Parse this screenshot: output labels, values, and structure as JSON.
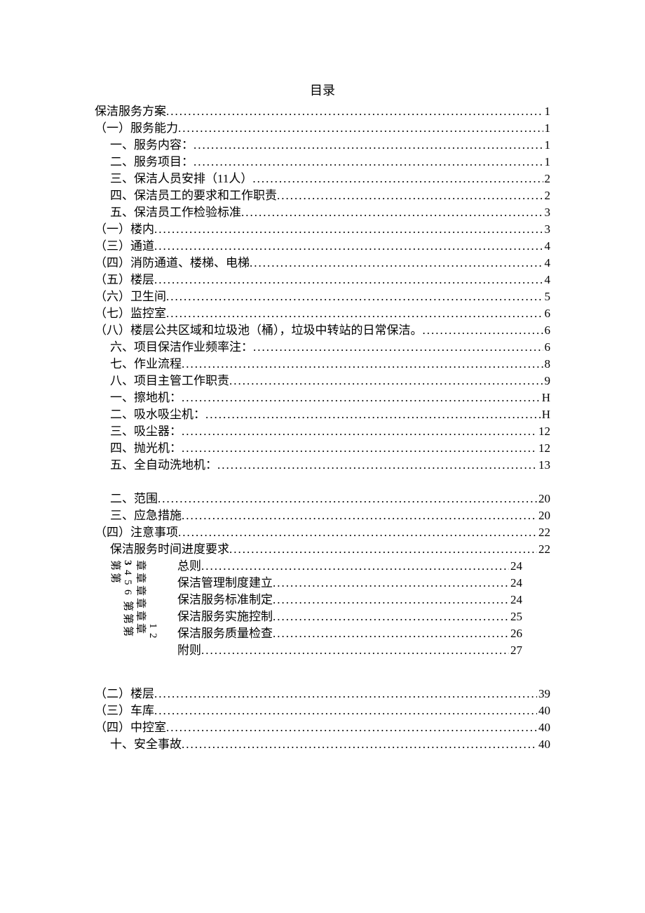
{
  "title": "目录",
  "toc": [
    {
      "label": "保洁服务方案",
      "page": "1",
      "indent": 0
    },
    {
      "label": "（一）服务能力",
      "page": "1",
      "indent": 1
    },
    {
      "label": "一、服务内容：",
      "page": "1",
      "indent": 2
    },
    {
      "label": "二、服务项目：",
      "page": "1",
      "indent": 2
    },
    {
      "label": "三、保洁人员安排（11人）",
      "page": "2",
      "indent": 2
    },
    {
      "label": "四、保洁员工的要求和工作职责",
      "page": "2",
      "indent": 2
    },
    {
      "label": "五、保洁员工作检验标准",
      "page": "3",
      "indent": 2
    },
    {
      "label": "（一）楼内",
      "page": "3",
      "indent": 1
    },
    {
      "label": "（三）通道",
      "page": "4",
      "indent": 1
    },
    {
      "label": "（四）消防通道、楼梯、电梯",
      "page": "4",
      "indent": 1
    },
    {
      "label": "（五）楼层",
      "page": "4",
      "indent": 1
    },
    {
      "label": "（六）卫生间",
      "page": "5",
      "indent": 1
    },
    {
      "label": "（七）监控室",
      "page": "6",
      "indent": 1
    },
    {
      "label": "（八）楼层公共区域和垃圾池（桶），垃圾中转站的日常保洁。",
      "page": "6",
      "indent": 1
    },
    {
      "label": "六、项目保洁作业频率注：",
      "page": "6",
      "indent": 2
    },
    {
      "label": "七、作业流程",
      "page": "8",
      "indent": 2
    },
    {
      "label": "八、项目主管工作职责",
      "page": "9",
      "indent": 2
    },
    {
      "label": "一、擦地机：",
      "page": "H",
      "indent": 2
    },
    {
      "label": "二、吸水吸尘机：",
      "page": "H",
      "indent": 2
    },
    {
      "label": "三、吸尘器：",
      "page": "12",
      "indent": 2
    },
    {
      "label": "四、抛光机：",
      "page": "12",
      "indent": 2
    },
    {
      "label": "五、全自动洗地机：",
      "page": "13",
      "indent": 2
    }
  ],
  "toc2": [
    {
      "label": "二、范围",
      "page": "20",
      "indent": 2
    },
    {
      "label": "三、应急措施",
      "page": "20",
      "indent": 2
    },
    {
      "label": "（四）注意事项",
      "page": "22",
      "indent": 1
    },
    {
      "label": "保洁服务时间进度要求",
      "page": "22",
      "indent": 2
    }
  ],
  "rotated": {
    "left_di": "第",
    "nums": [
      "3",
      "4",
      "5",
      "6"
    ],
    "zhang": "章",
    "di2": "第",
    "nums2": [
      "1",
      "2"
    ]
  },
  "chapters": [
    {
      "label": "总则",
      "page": "24"
    },
    {
      "label": "保洁管理制度建立",
      "page": "24"
    },
    {
      "label": "保洁服务标准制定",
      "page": "24"
    },
    {
      "label": "保洁服务实施控制",
      "page": "25"
    },
    {
      "label": "保洁服务质量检查",
      "page": "26"
    },
    {
      "label": "附则",
      "page": "27"
    }
  ],
  "toc3": [
    {
      "label": "（二）楼层",
      "page": "39",
      "indent": 1
    },
    {
      "label": "（三）车库",
      "page": "40",
      "indent": 1
    },
    {
      "label": "（四）中控室",
      "page": "40",
      "indent": 1
    },
    {
      "label": "十、安全事故",
      "page": "40",
      "indent": 2
    }
  ]
}
